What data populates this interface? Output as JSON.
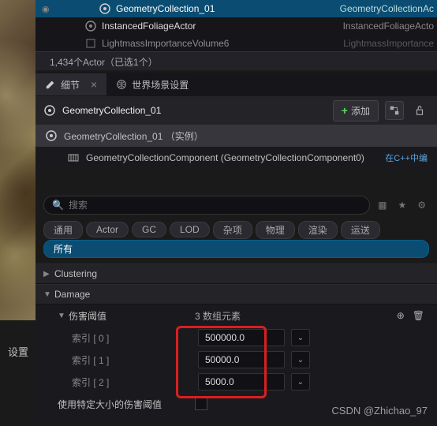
{
  "outliner": {
    "rows": [
      {
        "label": "GeometryCollection_01",
        "type": "GeometryCollectionAc",
        "selected": true,
        "eye": true
      },
      {
        "label": "InstancedFoliageActor",
        "type": "InstancedFoliageActo",
        "selected": false
      },
      {
        "label": "LightmassImportanceVolume6",
        "type": "LightmassImportance",
        "selected": false
      }
    ],
    "footer": "1,434个Actor（已选1个）"
  },
  "side_tab": "设置",
  "tabs": {
    "details": "细节",
    "world": "世界场景设置"
  },
  "header": {
    "title": "GeometryCollection_01",
    "add_label": "添加"
  },
  "components": {
    "root": "GeometryCollection_01 （实例）",
    "child": "GeometryCollectionComponent (GeometryCollectionComponent0)",
    "child_tag": "在C++中编"
  },
  "search": {
    "placeholder": "搜索"
  },
  "filters": [
    "通用",
    "Actor",
    "GC",
    "LOD",
    "杂项",
    "物理",
    "渲染",
    "运送"
  ],
  "filter_all": "所有",
  "categories": {
    "clustering": "Clustering",
    "damage": "Damage"
  },
  "damage": {
    "threshold_label": "伤害阈值",
    "array_meta": "3 数组元素",
    "items": [
      {
        "label": "索引 [ 0 ]",
        "value": "500000.0"
      },
      {
        "label": "索引 [ 1 ]",
        "value": "50000.0"
      },
      {
        "label": "索引 [ 2 ]",
        "value": "5000.0"
      }
    ],
    "size_specific_label": "使用特定大小的伤害阈值"
  },
  "watermark": "CSDN @Zhichao_97"
}
